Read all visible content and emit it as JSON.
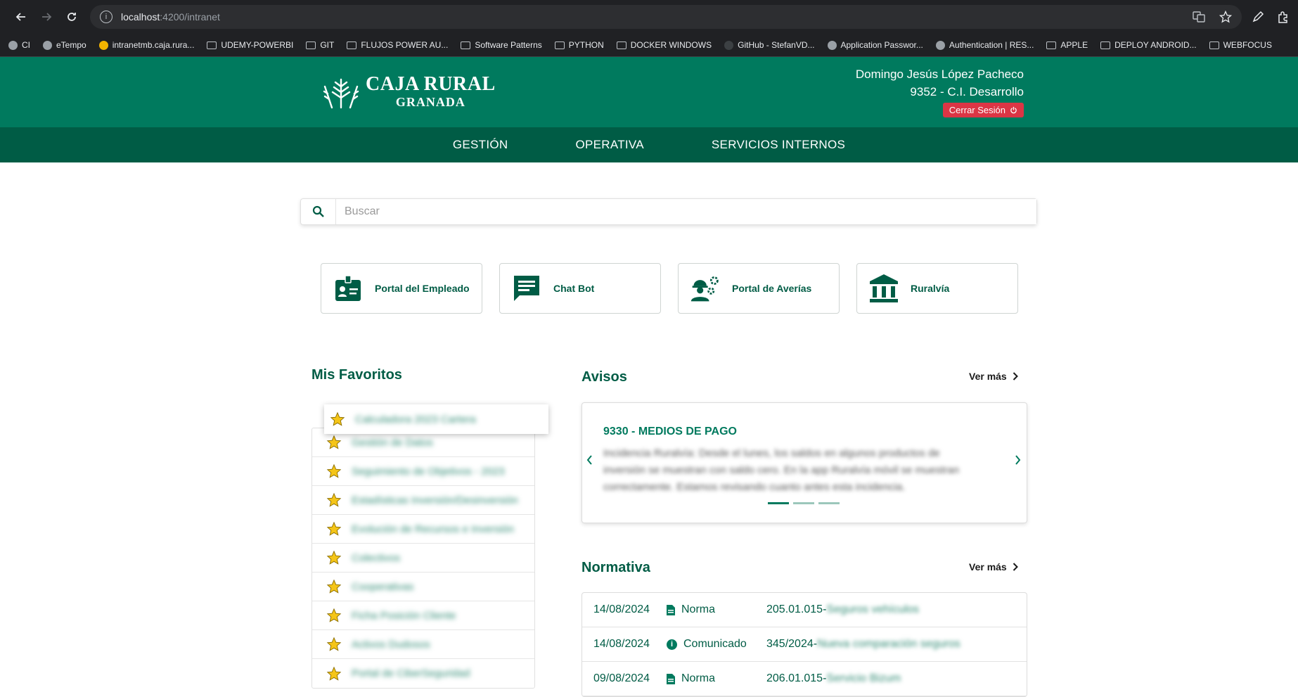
{
  "browser": {
    "url_host": "localhost",
    "url_path": ":4200/intranet",
    "bookmarks": [
      {
        "label": "CI",
        "icon": "dot"
      },
      {
        "label": "eTempo",
        "icon": "dot"
      },
      {
        "label": "intranetmb.caja.rura...",
        "icon": "dot-orange"
      },
      {
        "label": "UDEMY-POWERBI",
        "icon": "folder"
      },
      {
        "label": "GIT",
        "icon": "folder"
      },
      {
        "label": "FLUJOS POWER AU...",
        "icon": "folder"
      },
      {
        "label": "Software Patterns",
        "icon": "folder"
      },
      {
        "label": "PYTHON",
        "icon": "folder"
      },
      {
        "label": "DOCKER WINDOWS",
        "icon": "folder"
      },
      {
        "label": "GitHub - StefanVD...",
        "icon": "dot-dark"
      },
      {
        "label": "Application Passwor...",
        "icon": "dot"
      },
      {
        "label": "Authentication | RES...",
        "icon": "dot"
      },
      {
        "label": "APPLE",
        "icon": "folder"
      },
      {
        "label": "DEPLOY ANDROID...",
        "icon": "folder"
      },
      {
        "label": "WEBFOCUS",
        "icon": "folder"
      }
    ]
  },
  "header": {
    "logo_line1": "CAJA RURAL",
    "logo_line2": "GRANADA",
    "user_name": "Domingo Jesús López Pacheco",
    "user_office": "9352 - C.I. Desarrollo",
    "logout_label": "Cerrar Sesión"
  },
  "nav": {
    "items": [
      "GESTIÓN",
      "OPERATIVA",
      "SERVICIOS INTERNOS"
    ]
  },
  "search": {
    "placeholder": "Buscar"
  },
  "shortcuts": [
    {
      "label": "Portal del Empleado",
      "icon": "employee-badge-icon"
    },
    {
      "label": "Chat Bot",
      "icon": "chat-icon"
    },
    {
      "label": "Portal de Averías",
      "icon": "technician-gears-icon"
    },
    {
      "label": "Ruralvía",
      "icon": "bank-icon"
    }
  ],
  "favorites": {
    "title": "Mis Favoritos",
    "dragged_item": "Calculadora 2023 Cartera",
    "items": [
      "Gestión de Datos",
      "Seguimiento de Objetivos - 2023",
      "Estadísticas Inversión/Desinversión",
      "Evolución de Recursos e Inversión",
      "Colectivos",
      "Cooperativas",
      "Ficha Posición Cliente",
      "Activos Dudosos",
      "Portal de CiberSeguridad"
    ],
    "accent_color": "#f5c518"
  },
  "avisos": {
    "title": "Avisos",
    "more_label": "Ver más",
    "item_title": "9330 - MEDIOS DE PAGO",
    "item_text": "Incidencia Ruralvía: Desde el lunes, los saldos en algunos productos de inversión se muestran con saldo cero. En la app Ruralvía móvil se muestran correctamente. Estamos revisando cuanto antes esta incidencia."
  },
  "normativa": {
    "title": "Normativa",
    "more_label": "Ver más",
    "rows": [
      {
        "date": "14/08/2024",
        "type": "Norma",
        "icon": "document-icon",
        "code": "205.01.015-",
        "desc": "Seguros vehículos"
      },
      {
        "date": "14/08/2024",
        "type": "Comunicado",
        "icon": "info-icon",
        "code": "345/2024-",
        "desc": "Nueva comparación seguros"
      },
      {
        "date": "09/08/2024",
        "type": "Norma",
        "icon": "document-icon",
        "code": "206.01.015-",
        "desc": "Servicio Bizum"
      }
    ]
  },
  "colors": {
    "brand_green": "#007a5e",
    "nav_green": "#005c45",
    "logout_red": "#dc3545"
  }
}
